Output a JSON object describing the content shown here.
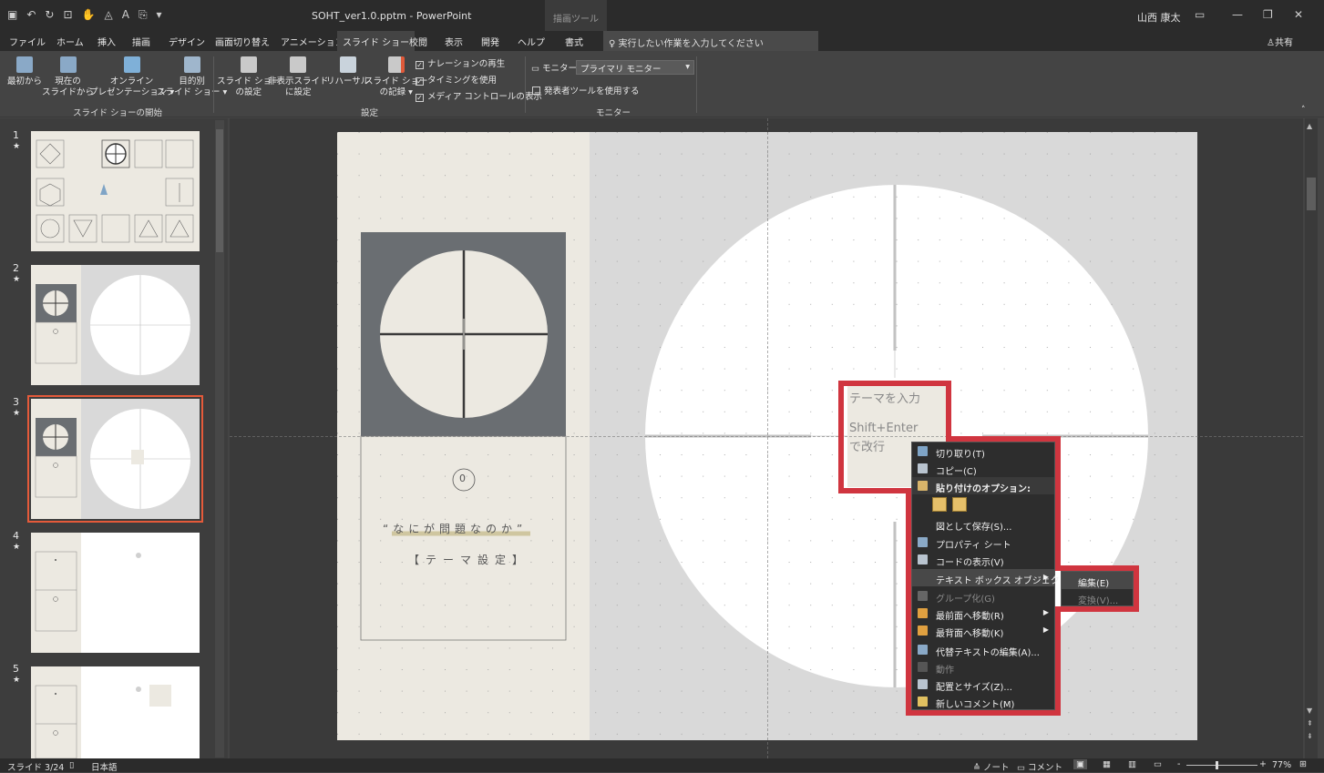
{
  "title_bar": {
    "title": "SOHT_ver1.0.pptm  -  PowerPoint",
    "drawing_tools": "描画ツール",
    "user": "山西 康太"
  },
  "tabs": [
    "ファイル",
    "ホーム",
    "挿入",
    "描画",
    "デザイン",
    "画面切り替え",
    "アニメーション",
    "スライド ショー",
    "校閲",
    "表示",
    "開発",
    "ヘルプ",
    "書式"
  ],
  "active_tab": "スライド ショー",
  "tell_me": "実行したい作業を入力してください",
  "share": "共有",
  "ribbon": {
    "start_group": {
      "label": "スライド ショーの開始",
      "btn_from_beginning": "最初から",
      "btn_from_current_1": "現在の",
      "btn_from_current_2": "スライドから",
      "btn_online_1": "オンライン",
      "btn_online_2": "プレゼンテーション ▾",
      "btn_custom_1": "目的別",
      "btn_custom_2": "スライド ショー ▾"
    },
    "setup_group": {
      "label": "設定",
      "btn_setup_1": "スライド ショー",
      "btn_setup_2": "の設定",
      "btn_hide_1": "非表示スライド",
      "btn_hide_2": "に設定",
      "btn_rehearse": "リハーサル",
      "btn_record_1": "スライド ショー",
      "btn_record_2": "の記録 ▾",
      "chk_narration": "ナレーションの再生",
      "chk_timing": "タイミングを使用",
      "chk_media": "メディア コントロールの表示"
    },
    "monitor_group": {
      "label": "モニター",
      "monitor_label": "モニター:",
      "monitor_value": "プライマリ モニター",
      "presenter_view": "発表者ツールを使用する"
    }
  },
  "thumbnails": [
    {
      "num": "1",
      "star": "★"
    },
    {
      "num": "2",
      "star": "★"
    },
    {
      "num": "3",
      "star": "★"
    },
    {
      "num": "4",
      "star": "★"
    },
    {
      "num": "5",
      "star": "★"
    }
  ],
  "slide": {
    "counter": "0",
    "question": "“なにが問題なのか”",
    "theme": "【テーマ設定】",
    "textbox_line1": "テーマを入力",
    "textbox_line2": "Shift+Enter",
    "textbox_line3": "で改行"
  },
  "context_menu": {
    "items": [
      {
        "label": "切り取り(T)",
        "disabled": false
      },
      {
        "label": "コピー(C)",
        "disabled": false
      },
      {
        "label": "貼り付けのオプション:",
        "disabled": false
      },
      {
        "label": "図として保存(S)...",
        "disabled": false
      },
      {
        "label": "プロパティ シート",
        "disabled": false
      },
      {
        "label": "コードの表示(V)",
        "disabled": false
      },
      {
        "label": "テキスト ボックス オブジェクト(O)",
        "disabled": false
      },
      {
        "label": "グループ化(G)",
        "disabled": true
      },
      {
        "label": "最前面へ移動(R)",
        "disabled": false
      },
      {
        "label": "最背面へ移動(K)",
        "disabled": false
      },
      {
        "label": "代替テキストの編集(A)...",
        "disabled": false
      },
      {
        "label": "動作",
        "disabled": true
      },
      {
        "label": "配置とサイズ(Z)...",
        "disabled": false
      },
      {
        "label": "新しいコメント(M)",
        "disabled": false
      }
    ],
    "submenu": [
      {
        "label": "編集(E)",
        "disabled": false
      },
      {
        "label": "変換(V)...",
        "disabled": true
      }
    ]
  },
  "status_bar": {
    "slide_count": "スライド 3/24",
    "language": "日本語",
    "notes": "ノート",
    "comments": "コメント",
    "zoom": "77%"
  },
  "colors": {
    "accent_red": "#d0353f",
    "selected_thumb": "#e55a3a",
    "slide_left_panel": "#ece9e1",
    "dark_box": "#6a6e72"
  }
}
